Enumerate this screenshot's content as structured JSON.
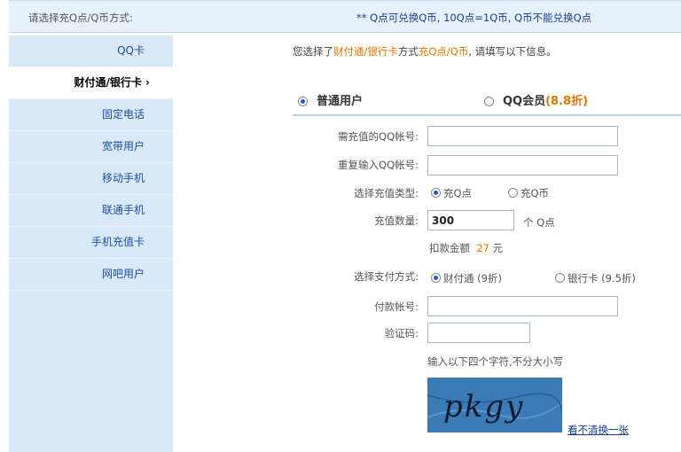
{
  "header": {
    "left_text": "请选择充Q点/Q币方式:",
    "right_text": "** Q点可兑换Q币, 10Q点=1Q币, Q币不能兑换Q点"
  },
  "sidebar": {
    "items": [
      {
        "label": "QQ卡"
      },
      {
        "label": "财付通/银行卡 ›"
      },
      {
        "label": "固定电话"
      },
      {
        "label": "宽带用户"
      },
      {
        "label": "移动手机"
      },
      {
        "label": "联通手机"
      },
      {
        "label": "手机充值卡"
      },
      {
        "label": "网吧用户"
      }
    ],
    "active_index": 1
  },
  "intro": {
    "prefix": "您选择了",
    "method": "财付通/银行卡",
    "middle": "方式",
    "target": "充Q点/Q币",
    "suffix": ", 请填写以下信息。"
  },
  "user_type": {
    "normal": "普通用户",
    "vip": "QQ会员",
    "vip_discount": "(8.8折)",
    "selected": "normal"
  },
  "form": {
    "qq_label": "需充值的QQ帐号:",
    "qq_value": "",
    "qq_confirm_label": "重复输入QQ帐号:",
    "qq_confirm_value": "",
    "type_label": "选择充值类型:",
    "type_options": [
      "充Q点",
      "充Q币"
    ],
    "type_selected": 0,
    "amount_label": "充值数量:",
    "amount_value": "300",
    "amount_unit": "个  Q点",
    "deduct_prefix": "扣款金额",
    "deduct_value": "27",
    "deduct_unit": "元",
    "pay_label": "选择支付方式:",
    "pay_options": [
      "财付通 (9折)",
      "银行卡 (9.5折)"
    ],
    "pay_selected": 0,
    "account_label": "付款帐号:",
    "account_value": "",
    "captcha_label": "验证码:",
    "captcha_value": "",
    "captcha_hint": "输入以下四个字符,不分大小写",
    "captcha_image_text": "pkgy",
    "captcha_refresh": "看不清换一张"
  },
  "colors": {
    "accent_orange": "#e07700",
    "sidebar_bg": "#d9e9f8",
    "link_blue": "#1a3c8c"
  }
}
